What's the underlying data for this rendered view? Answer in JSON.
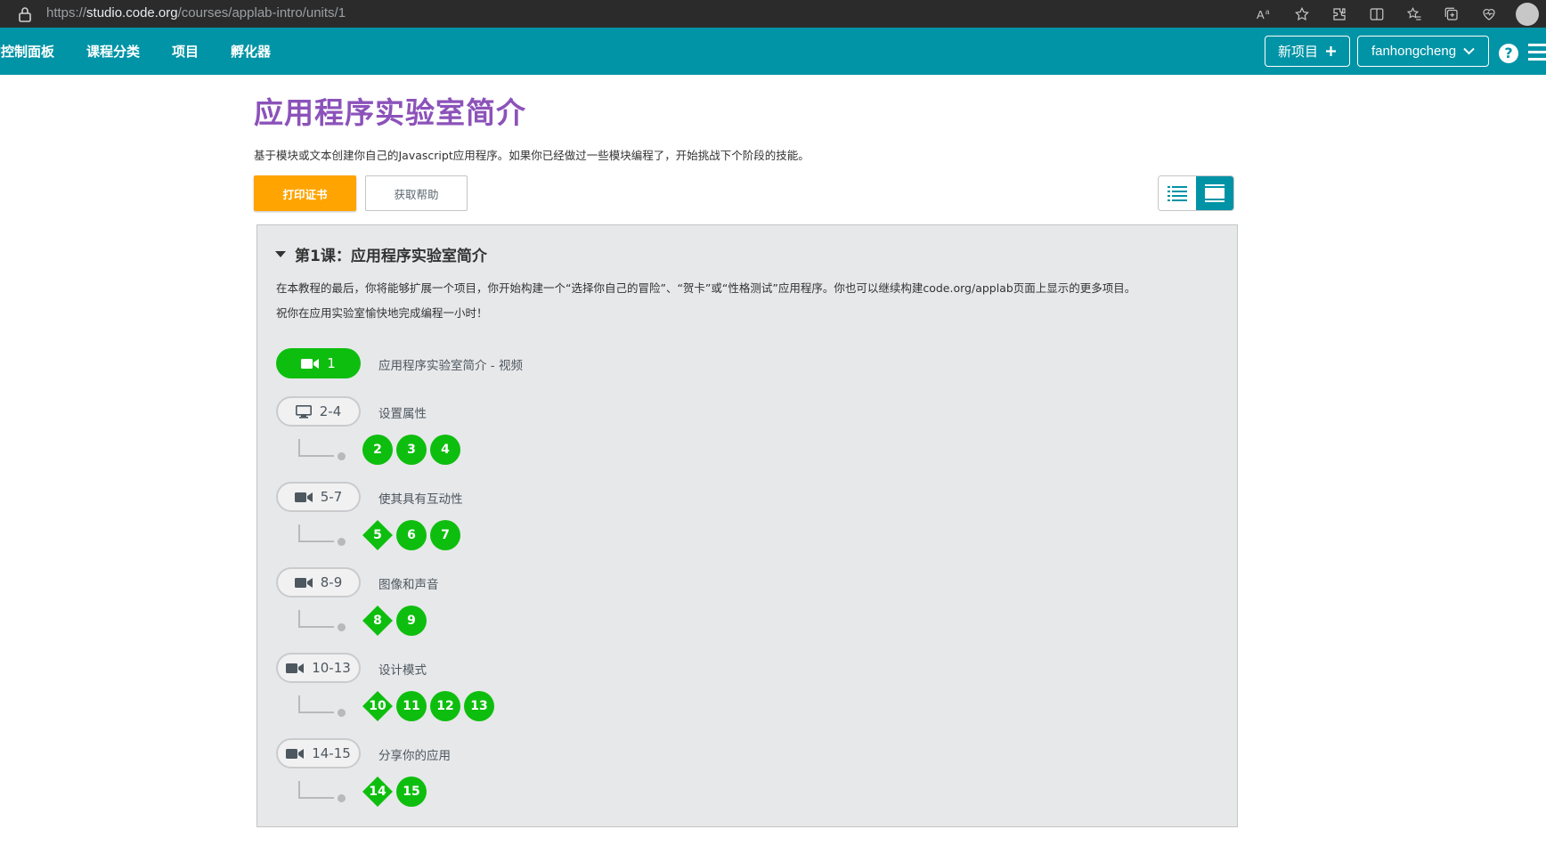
{
  "browser": {
    "url_prefix": "https://",
    "url_host": "studio.code.org",
    "url_path": "/courses/applab-intro/units/1"
  },
  "header": {
    "nav": [
      "我的控制面板",
      "课程分类",
      "项目",
      "孵化器"
    ],
    "nav_display": [
      "的控制面板",
      "课程分类",
      "项目",
      "孵化器"
    ],
    "new_project": "新项目",
    "username": "fanhongcheng",
    "help": "?"
  },
  "page": {
    "title": "应用程序实验室简介",
    "description": "基于模块或文本创建你自己的Javascript应用程序。如果你已经做过一些模块编程了，开始挑战下个阶段的技能。",
    "print_cert": "打印证书",
    "get_help": "获取帮助"
  },
  "lesson": {
    "title": "第1课：应用程序实验室简介",
    "desc1": "在本教程的最后，你将能够扩展一个项目，你开始构建一个“选择你自己的冒险”、“贺卡”或“性格测试”应用程序。你也可以继续构建code.org/applab页面上显示的更多项目。",
    "desc2": "祝你在应用实验室愉快地完成编程一小时！",
    "steps": [
      {
        "range": "1",
        "icon": "video-icon",
        "status": "done",
        "name": "应用程序实验室简介 - 视频",
        "levels": []
      },
      {
        "range": "2-4",
        "icon": "monitor-icon",
        "status": "outline",
        "name": "设置属性",
        "levels": [
          {
            "n": "2",
            "shape": "circle"
          },
          {
            "n": "3",
            "shape": "circle"
          },
          {
            "n": "4",
            "shape": "circle"
          }
        ]
      },
      {
        "range": "5-7",
        "icon": "video-icon",
        "status": "outline",
        "name": "使其具有互动性",
        "levels": [
          {
            "n": "5",
            "shape": "diamond"
          },
          {
            "n": "6",
            "shape": "circle"
          },
          {
            "n": "7",
            "shape": "circle"
          }
        ]
      },
      {
        "range": "8-9",
        "icon": "video-icon",
        "status": "outline",
        "name": "图像和声音",
        "levels": [
          {
            "n": "8",
            "shape": "diamond"
          },
          {
            "n": "9",
            "shape": "circle"
          }
        ]
      },
      {
        "range": "10-13",
        "icon": "video-icon",
        "status": "outline",
        "name": "设计模式",
        "levels": [
          {
            "n": "10",
            "shape": "diamond"
          },
          {
            "n": "11",
            "shape": "circle"
          },
          {
            "n": "12",
            "shape": "circle"
          },
          {
            "n": "13",
            "shape": "circle"
          }
        ]
      },
      {
        "range": "14-15",
        "icon": "video-icon",
        "status": "outline",
        "name": "分享你的应用",
        "levels": [
          {
            "n": "14",
            "shape": "diamond"
          },
          {
            "n": "15",
            "shape": "circle"
          }
        ]
      }
    ]
  },
  "colors": {
    "header": "#0094a6",
    "title": "#8c52ba",
    "cert_button": "#ffa400",
    "complete": "#0ebe0e"
  }
}
